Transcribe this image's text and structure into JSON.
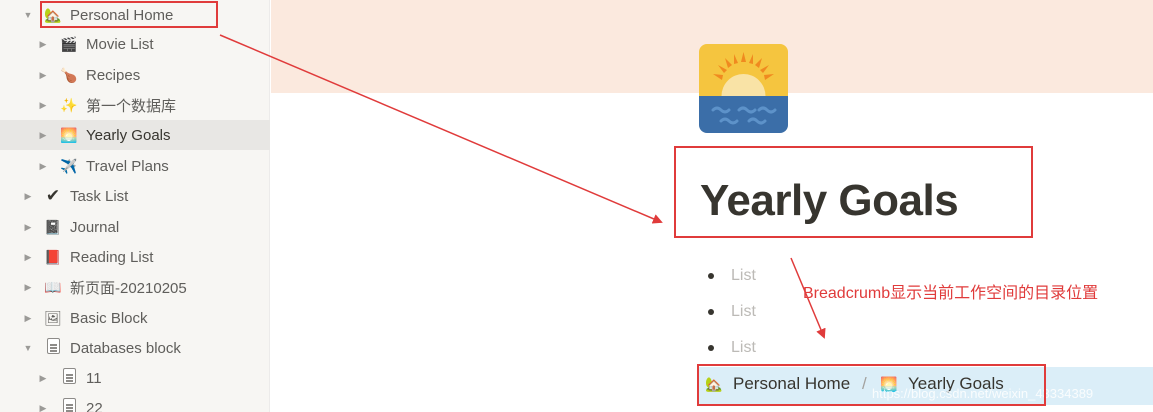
{
  "sidebar": {
    "items": [
      {
        "label": "Personal Home",
        "emoji": "🏡",
        "toggle": "▼"
      },
      {
        "label": "Movie List",
        "emoji": "🎬",
        "toggle": "▶"
      },
      {
        "label": "Recipes",
        "emoji": "🍗",
        "toggle": "▶"
      },
      {
        "label": "第一个数据库",
        "emoji": "✨",
        "toggle": "▶"
      },
      {
        "label": "Yearly Goals",
        "emoji": "🌅",
        "toggle": "▶"
      },
      {
        "label": "Travel Plans",
        "emoji": "✈️",
        "toggle": "▶"
      },
      {
        "label": "Task List",
        "emoji": "✔",
        "toggle": "▶"
      },
      {
        "label": "Journal",
        "emoji": "📓",
        "toggle": "▶"
      },
      {
        "label": "Reading List",
        "emoji": "📕",
        "toggle": "▶"
      },
      {
        "label": "新页面-20210205",
        "emoji": "📖",
        "toggle": "▶"
      },
      {
        "label": "Basic Block",
        "emoji": "🖼",
        "toggle": "▶"
      },
      {
        "label": "Databases block",
        "emoji": "",
        "toggle": "▼"
      },
      {
        "label": "11",
        "emoji": "",
        "toggle": "▶"
      },
      {
        "label": "22",
        "emoji": "",
        "toggle": "▶"
      }
    ]
  },
  "page": {
    "title": "Yearly Goals",
    "icon": "sunrise-icon",
    "bullets": [
      "List",
      "List",
      "List"
    ]
  },
  "breadcrumb": {
    "items": [
      {
        "label": "Personal Home",
        "emoji": "🏡"
      },
      {
        "label": "Yearly Goals",
        "emoji": "🌅"
      }
    ],
    "separator": "/"
  },
  "annotation": {
    "text": "Breadcrumb显示当前工作空间的目录位置",
    "color": "#e03b3b"
  },
  "watermark": "https://blog.csdn.net/weixin_43334389",
  "colors": {
    "cover": "#fbe9de",
    "sidebar": "#f7f6f3",
    "breadcrumb_bar": "#dbeef8"
  }
}
